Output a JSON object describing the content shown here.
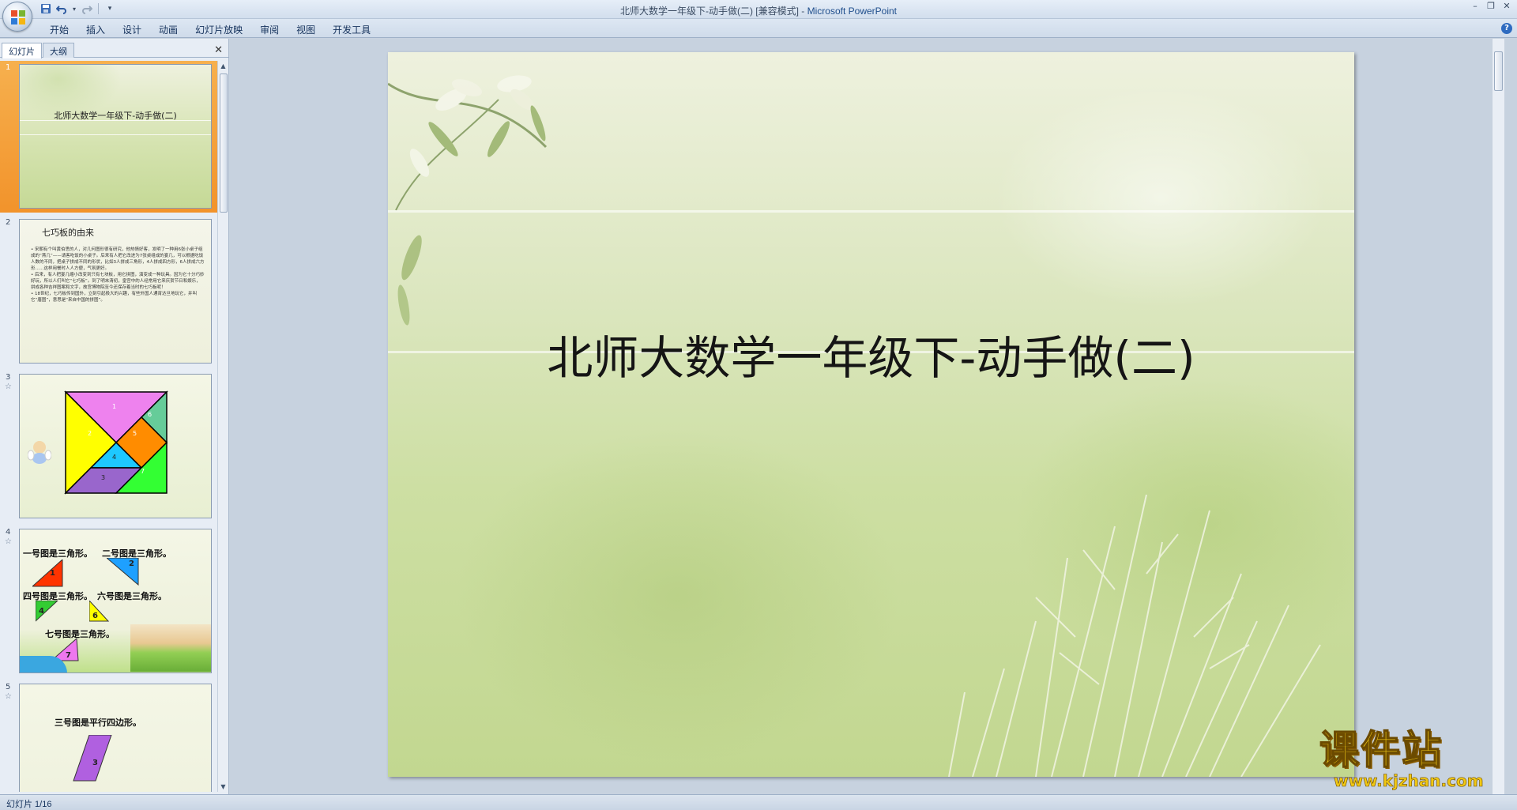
{
  "window": {
    "title": "北师大数学一年级下-动手做(二) [兼容模式] - ",
    "app_name": "Microsoft PowerPoint"
  },
  "ribbon": {
    "tabs": [
      "开始",
      "插入",
      "设计",
      "动画",
      "幻灯片放映",
      "审阅",
      "视图",
      "开发工具"
    ]
  },
  "left_pane": {
    "tabs": [
      "幻灯片",
      "大纲"
    ],
    "slides": [
      {
        "number": "1",
        "title": "北师大数学一年级下-动手做(二)"
      },
      {
        "number": "2",
        "title": "七巧板的由来",
        "body": [
          "• 宋朝有个叫黄伯思的人，对几何图形很有研究，他热情好客，发明了一种用6张小桌子组成的“燕几”——请客吃饭的小桌子。后来有人把它改进为7张桌组成的宴几，可以根据吃饭人数的不同，把桌子拼成不同的形状，比如3人拼成三角形，4人拼成四方形，6人拼成六方形……这样用餐时人人方便，气氛更好。",
          "• 后来，有人把宴几缩小改变到只有七块板，用它拼图，演变成一种玩具。因为它十分巧妙好玩，所以人们叫它“七巧板”。到了明末清初，皇宫中的人经常用它来庆贺节日和娱乐，拼成各种吉祥图案和文字，故宫博物院至今还保存着当时的七巧板呢！",
          "• 18世纪，七巧板传到国外，立刻引起极大的兴趣，有些外国人通宵达旦地玩它，并叫它“唐图”，意思是“来自中国的拼图”。"
        ]
      },
      {
        "number": "3",
        "tangram_labels": [
          "1",
          "2",
          "3",
          "4",
          "5",
          "6",
          "7"
        ]
      },
      {
        "number": "4",
        "lines": [
          "一号图是三角形。",
          "二号图是三角形。",
          "四号图是三角形。",
          "六号图是三角形。",
          "七号图是三角形。"
        ],
        "shape_labels": [
          "1",
          "2",
          "4",
          "6",
          "7"
        ]
      },
      {
        "number": "5",
        "lines": [
          "三号图是平行四边形。"
        ],
        "shape_labels": [
          "3"
        ]
      }
    ]
  },
  "slide": {
    "title": "北师大数学一年级下-动手做(二)"
  },
  "status": {
    "slide_indicator": "幻灯片 1/16"
  },
  "watermark": {
    "big": "课件站",
    "small": "www.kjzhan.com"
  },
  "colors": {
    "selected_thumb": "#f2932b",
    "ribbon": "#dde7f3",
    "watermark": "#f0c814"
  }
}
